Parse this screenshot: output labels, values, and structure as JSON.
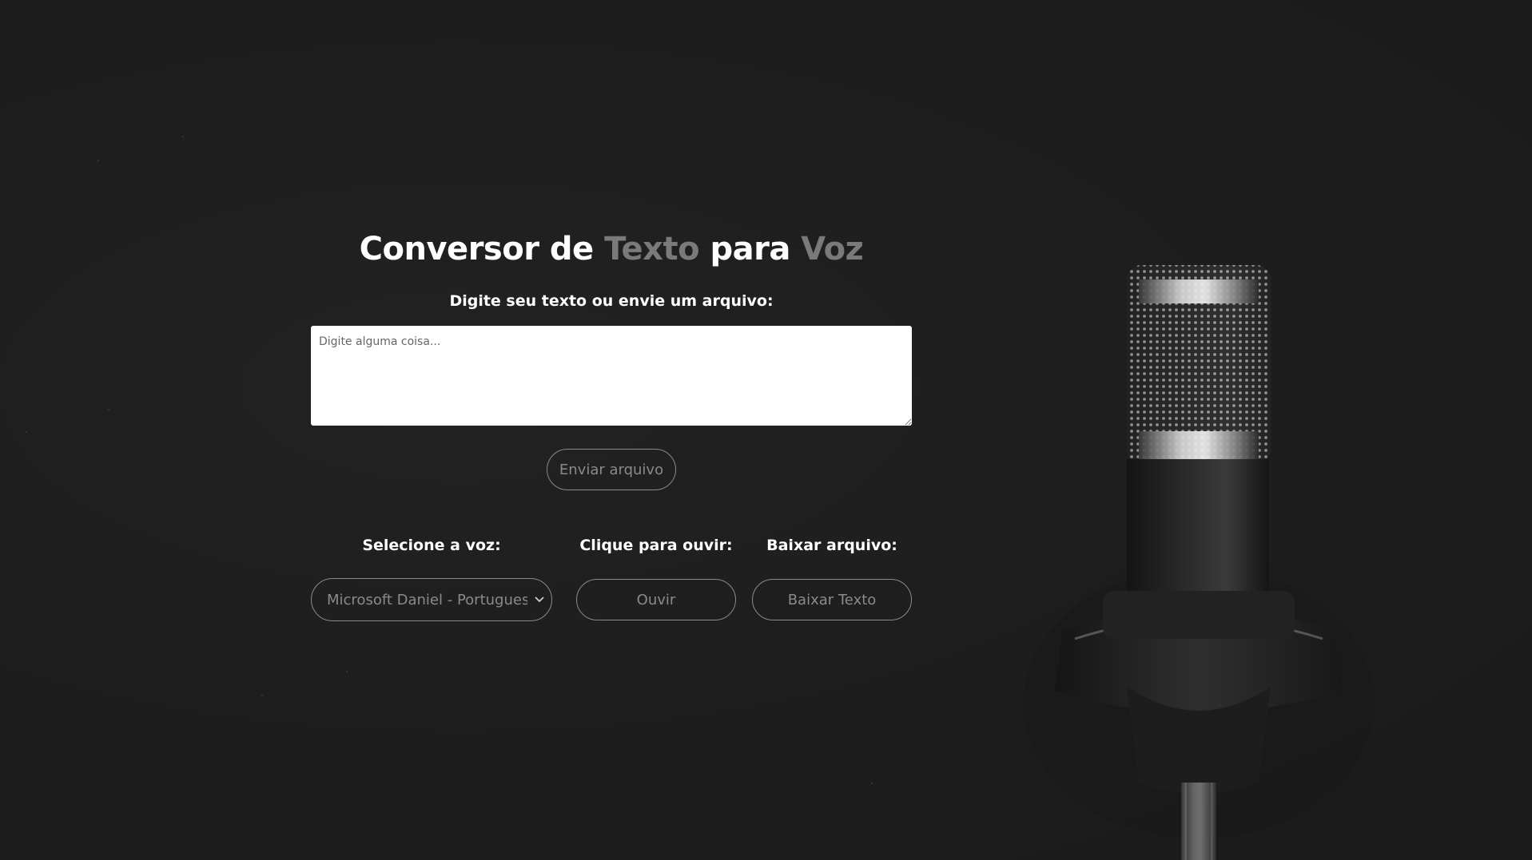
{
  "header": {
    "title_part1": "Conversor de",
    "title_accent1": "Texto",
    "title_part2": "para",
    "title_accent2": "Voz"
  },
  "input": {
    "label": "Digite seu texto ou envie um arquivo:",
    "placeholder": "Digite alguma coisa...",
    "value": ""
  },
  "upload": {
    "label": "Enviar arquivo"
  },
  "controls": {
    "voice_label": "Selecione a voz:",
    "voice_selected": "Microsoft Daniel - Portuguese",
    "listen_label": "Clique para ouvir:",
    "listen_button": "Ouvir",
    "download_label": "Baixar arquivo:",
    "download_button": "Baixar Texto"
  },
  "colors": {
    "background": "#1c1c1c",
    "accent_gray": "#7a7a7a",
    "button_border": "#8a8a8a"
  }
}
